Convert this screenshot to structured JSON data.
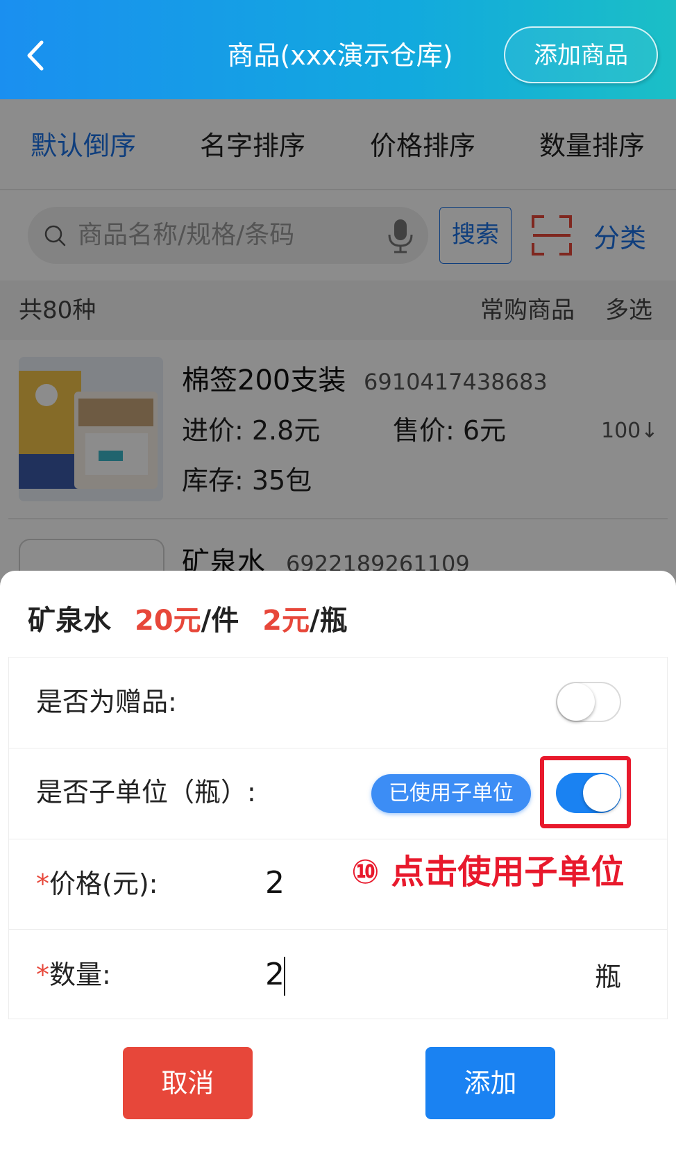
{
  "header": {
    "title": "商品(xxx演示仓库)",
    "add_button": "添加商品"
  },
  "sort_tabs": [
    {
      "label": "默认倒序",
      "active": true
    },
    {
      "label": "名字排序",
      "active": false
    },
    {
      "label": "价格排序",
      "active": false
    },
    {
      "label": "数量排序",
      "active": false
    }
  ],
  "search": {
    "placeholder": "商品名称/规格/条码",
    "button": "搜索",
    "category": "分类"
  },
  "list_meta": {
    "count": "共80种",
    "frequent": "常购商品",
    "multi_select": "多选"
  },
  "products": [
    {
      "name": "棉签200支装",
      "barcode": "6910417438683",
      "purchase_price": "进价: 2.8元",
      "sale_price": "售价: 6元",
      "stock": "库存: 35包",
      "sort_badge": "100↓"
    },
    {
      "name": "矿泉水",
      "barcode": "6922189261109"
    }
  ],
  "sheet": {
    "product_name": "矿泉水",
    "price_pack": "20元",
    "unit_pack": "/件",
    "price_unit": "2元",
    "unit_sub": "/瓶",
    "gift_label": "是否为赠品:",
    "gift_on": false,
    "subunit_label": "是否子单位（瓶）:",
    "subunit_on": true,
    "subunit_badge": "已使用子单位",
    "annotation": "⑩ 点击使用子单位",
    "price_label": "价格(元):",
    "price_value": "2",
    "qty_label": "数量:",
    "qty_value": "2",
    "qty_unit": "瓶",
    "required_mark": "*",
    "cancel": "取消",
    "confirm": "添加"
  },
  "colors": {
    "accent": "#1a82f2",
    "danger": "#e7473a",
    "highlight": "#e8192c"
  }
}
